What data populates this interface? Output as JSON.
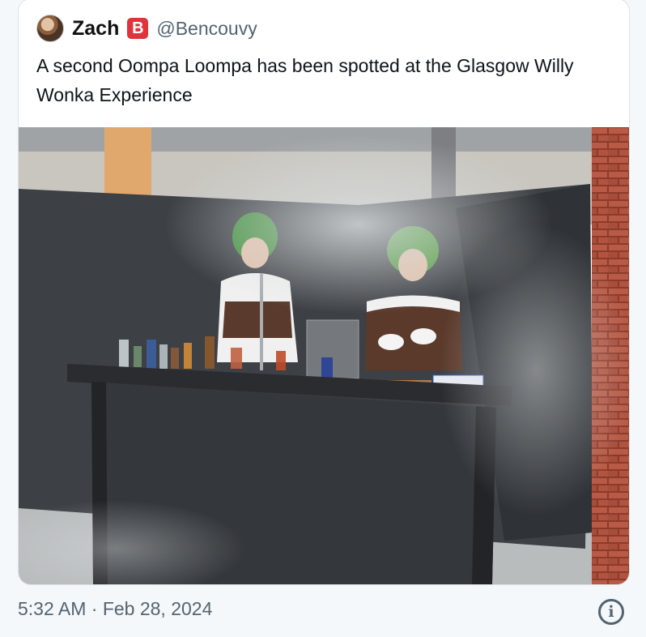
{
  "tweet": {
    "author_name": "Zach",
    "badge_letter": "B",
    "badge_color": "#e0333b",
    "handle": "@Bencouvy",
    "text": "A second Oompa Loompa has been spotted at the Glasgow Willy Wonka Experience",
    "timestamp": "5:32 AM · Feb 28, 2024",
    "info_icon": "info-icon"
  },
  "colors": {
    "text_primary": "#0f1419",
    "text_secondary": "#536471"
  }
}
